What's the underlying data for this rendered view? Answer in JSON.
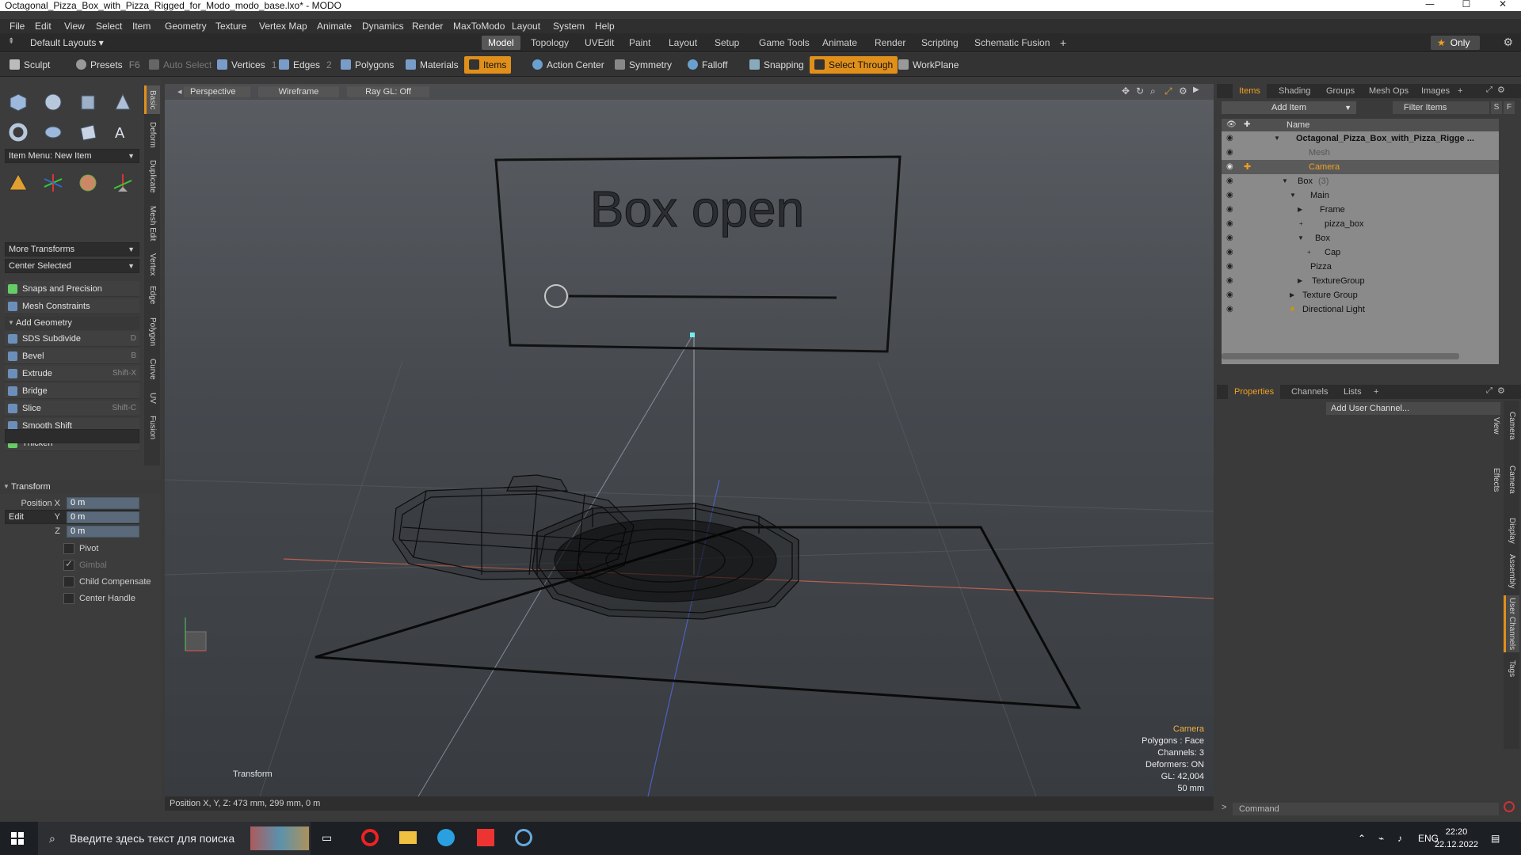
{
  "window": {
    "title": "Octagonal_Pizza_Box_with_Pizza_Rigged_for_Modo_modo_base.lxo* - MODO",
    "minimize": "—",
    "maximize": "☐",
    "close": "✕"
  },
  "menu": [
    "File",
    "Edit",
    "View",
    "Select",
    "Item",
    "Geometry",
    "Texture",
    "Vertex Map",
    "Animate",
    "Dynamics",
    "Render",
    "MaxToModo",
    "Layout",
    "System",
    "Help"
  ],
  "layoutbar": {
    "default_layouts": "Default Layouts",
    "tabs": [
      "Model",
      "Topology",
      "UVEdit",
      "Paint",
      "Layout",
      "Setup",
      "Game Tools",
      "Animate",
      "Render",
      "Scripting",
      "Schematic Fusion"
    ],
    "active_tab": "Model",
    "plus": "+",
    "only": "Only"
  },
  "toolbar": {
    "sculpt": "Sculpt",
    "presets": "Presets",
    "presets_key": "F6",
    "auto_select": "Auto Select",
    "vertices": "Vertices",
    "vertices_key": "1",
    "edges": "Edges",
    "edges_key": "2",
    "polygons": "Polygons",
    "materials": "Materials",
    "items": "Items",
    "action_center": "Action Center",
    "symmetry": "Symmetry",
    "falloff": "Falloff",
    "snapping": "Snapping",
    "select_through": "Select Through",
    "workplane": "WorkPlane"
  },
  "left": {
    "item_menu": "Item Menu: New Item",
    "more_transforms": "More Transforms",
    "center_selected": "Center Selected",
    "snaps": "Snaps and Precision",
    "mesh_constraints": "Mesh Constraints",
    "add_geometry": "Add Geometry",
    "tools": [
      {
        "label": "SDS Subdivide",
        "key": "D"
      },
      {
        "label": "Bevel",
        "key": "B"
      },
      {
        "label": "Extrude",
        "key": "Shift-X"
      },
      {
        "label": "Bridge",
        "key": ""
      },
      {
        "label": "Slice",
        "key": "Shift-C"
      },
      {
        "label": "Smooth Shift",
        "key": ""
      },
      {
        "label": "Thicken",
        "key": ""
      }
    ],
    "edit": "Edit",
    "vtabs": [
      "Basic",
      "Deform",
      "Duplicate",
      "Mesh Edit",
      "Vertex",
      "Edge",
      "Polygon",
      "Curve",
      "UV",
      "Fusion"
    ],
    "transform": {
      "header": "Transform",
      "position_x_label": "Position X",
      "y_label": "Y",
      "z_label": "Z",
      "x": "0 m",
      "y": "0 m",
      "z": "0 m",
      "pivot": "Pivot",
      "gimbal": "Gimbal",
      "child_compensate": "Child Compensate",
      "center_handle": "Center Handle"
    }
  },
  "viewport": {
    "perspective": "Perspective",
    "wireframe": "Wireframe",
    "raygl": "Ray GL: Off",
    "sign_text": "Box open",
    "transform_label": "Transform",
    "info": {
      "camera": "Camera",
      "polygons": "Polygons : Face",
      "channels": "Channels: 3",
      "deformers": "Deformers: ON",
      "gl": "GL: 42,004",
      "focal": "50 mm"
    },
    "status": "Position X, Y, Z:   473 mm, 299 mm, 0 m"
  },
  "items_panel": {
    "tabs": [
      "Items",
      "Shading",
      "Groups",
      "Mesh Ops",
      "Images",
      "+"
    ],
    "add_item": "Add Item",
    "filter": "Filter Items",
    "s": "S",
    "f": "F",
    "name_col": "Name",
    "rows": [
      {
        "label": "Octagonal_Pizza_Box_with_Pizza_Rigge ...",
        "indent": 0
      },
      {
        "label": "Mesh",
        "indent": 1
      },
      {
        "label": "Camera",
        "indent": 1
      },
      {
        "label": "Box",
        "extra": "(3)",
        "indent": 1
      },
      {
        "label": "Main",
        "indent": 2
      },
      {
        "label": "Frame",
        "indent": 3
      },
      {
        "label": "pizza_box",
        "indent": 3
      },
      {
        "label": "Box",
        "indent": 3
      },
      {
        "label": "Cap",
        "indent": 4
      },
      {
        "label": "Pizza",
        "indent": 2
      },
      {
        "label": "TextureGroup",
        "indent": 2
      },
      {
        "label": "Texture Group",
        "indent": 1
      },
      {
        "label": "Directional Light",
        "indent": 1
      }
    ]
  },
  "props_panel": {
    "tabs": [
      "Properties",
      "Channels",
      "Lists",
      "+"
    ],
    "add_user_channel": "Add User Channel...",
    "vtabs": [
      "Camera View",
      "Camera Effects",
      "Display",
      "Assembly",
      "User Channels",
      "Tags"
    ],
    "command": "Command"
  },
  "taskbar": {
    "search": "Введите здесь текст для поиска",
    "lang": "ENG",
    "time": "22:20",
    "date": "22.12.2022"
  },
  "colors": {
    "accent": "#e0901a",
    "camera_label": "#f0b040"
  }
}
